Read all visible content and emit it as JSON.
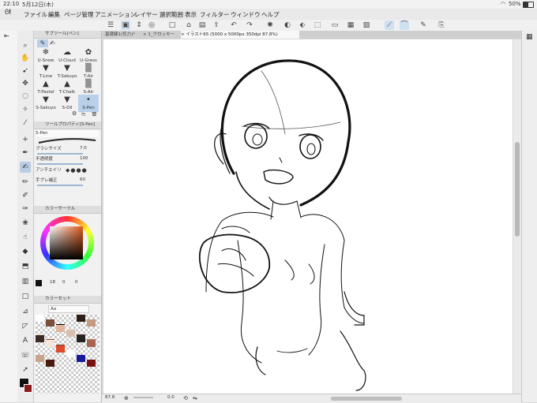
{
  "status": {
    "time": "22:10",
    "date": "5月12日(木)",
    "wifi": "wifi-icon",
    "battery": "50%"
  },
  "menu": [
    "ファイル",
    "編集",
    "ページ管理",
    "アニメーション",
    "レイヤー",
    "選択範囲",
    "表示",
    "フィルター",
    "ウィンドウ",
    "ヘルプ"
  ],
  "tabs": [
    {
      "label": "基礎練1(気力)*"
    },
    {
      "label": "× 1_クロッキー"
    },
    {
      "label": "× イラスト65 (5000 x 5000px 350dpi 87.8%)"
    }
  ],
  "subtool_panel": {
    "title": "サブツール[ペン]"
  },
  "subtools": [
    {
      "label": "U-Snow"
    },
    {
      "label": "U-Cloud"
    },
    {
      "label": "U-Gress"
    },
    {
      "label": "T-Line"
    },
    {
      "label": "T-Sakuyo"
    },
    {
      "label": "T-Air"
    },
    {
      "label": "T-Pastel"
    },
    {
      "label": "T-Chalk"
    },
    {
      "label": "S-Air"
    },
    {
      "label": "S-Sakuyo"
    },
    {
      "label": "S-Oil"
    },
    {
      "label": "S-Pen"
    }
  ],
  "tool_property": {
    "title": "ツールプロパティ[S-Pen]",
    "tool_name": "S-Pen",
    "brush_size_label": "ブラシサイズ",
    "brush_size_value": "7.0",
    "opacity_label": "不透明度",
    "opacity_value": "100",
    "antialias_label": "アンチエイリ",
    "stabilize_label": "手ブレ補正",
    "stabilize_value": "60"
  },
  "color_circle": {
    "title": "カラーサークル",
    "h": "18",
    "s": "0",
    "v": "0"
  },
  "color_set": {
    "title": "カラーセット",
    "set_name": "Aa"
  },
  "footer": {
    "zoom": "87.8",
    "angle": "0.0"
  },
  "colors": {
    "selection": "#b9d0ea",
    "canvas": "#ffffff",
    "main_color": "#111111",
    "sub_color": "#8b1a1a"
  }
}
